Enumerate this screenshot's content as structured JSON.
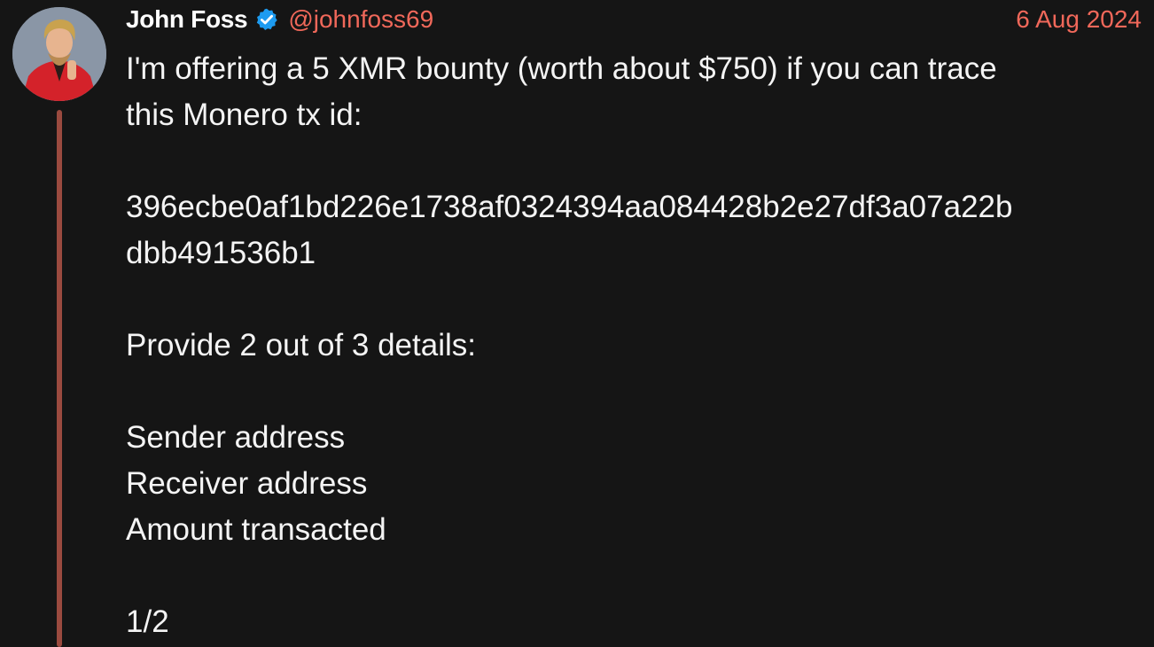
{
  "tweet": {
    "author_name": "John Foss",
    "handle": "@johnfoss69",
    "date": "6 Aug 2024",
    "verified_icon": "verified-badge-icon",
    "colors": {
      "background": "#151515",
      "accent": "#f0685a",
      "verified": "#1d9bf0",
      "thread_line": "#9a4a3f"
    },
    "lines": {
      "intro_1": "I'm offering a 5 XMR bounty (worth about $750) if you can trace",
      "intro_2": "this Monero tx id:",
      "txid_1": "396ecbe0af1bd226e1738af0324394aa084428b2e27df3a07a22b",
      "txid_2": "dbb491536b1",
      "provide": "Provide 2 out of 3 details:",
      "detail_1": "Sender address",
      "detail_2": "Receiver address",
      "detail_3": "Amount transacted",
      "counter": "1/2"
    }
  }
}
